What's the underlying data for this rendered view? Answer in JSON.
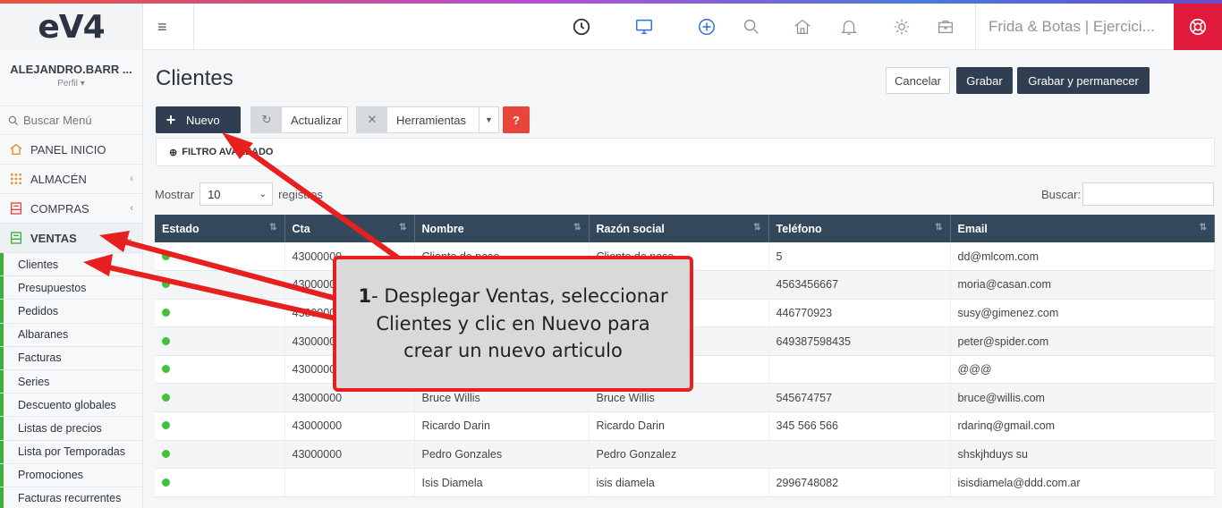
{
  "header": {
    "logo": "eV4",
    "menu_icon": "hamburger-icon",
    "icons": [
      "dashboard-clock-icon",
      "monitor-icon",
      "plus-circle-icon",
      "search-icon",
      "home-icon",
      "bell-icon",
      "gear-icon",
      "briefcase-icon"
    ],
    "company": "Frida & Botas | Ejercici...",
    "help_icon": "lifebuoy-icon"
  },
  "sidebar": {
    "user_name": "ALEJANDRO.BARR ...",
    "user_profile": "Perfil ▾",
    "search_placeholder": "Buscar Menú",
    "items": [
      {
        "label": "PANEL INICIO",
        "icon": "home-icon"
      },
      {
        "label": "ALMACÉN",
        "icon": "grid-icon"
      },
      {
        "label": "COMPRAS",
        "icon": "register-icon"
      },
      {
        "label": "VENTAS",
        "icon": "register-icon"
      }
    ],
    "ventas_sub": [
      "Clientes",
      "Presupuestos",
      "Pedidos",
      "Albaranes",
      "Facturas",
      "Series",
      "Descuento globales",
      "Listas de precios",
      "Lista por Temporadas",
      "Promociones",
      "Facturas recurrentes"
    ]
  },
  "main": {
    "title": "Clientes",
    "cancel_label": "Cancelar",
    "save_label": "Grabar",
    "save_stay_label": "Grabar y permanecer",
    "new_label": "Nuevo",
    "refresh_label": "Actualizar",
    "tools_label": "Herramientas",
    "help_label": "?",
    "filter_label": "FILTRO AVANZADO",
    "show_label": "Mostrar",
    "page_size": "10",
    "records_label": "registros",
    "search_label": "Buscar:",
    "columns": [
      "Estado",
      "Cta",
      "Nombre",
      "Razón social",
      "Teléfono",
      "Email"
    ],
    "rows": [
      {
        "cta": "43000000",
        "nombre": "Cliente de paso",
        "razon": "Cliente de paso",
        "telefono": "5",
        "email": "dd@mlcom.com"
      },
      {
        "cta": "43000000",
        "nombre": "",
        "razon": "",
        "telefono": "4563456667",
        "email": "moria@casan.com"
      },
      {
        "cta": "43000000",
        "nombre": "",
        "razon": "",
        "telefono": "446770923",
        "email": "susy@gimenez.com"
      },
      {
        "cta": "43000000",
        "nombre": "",
        "razon": "",
        "telefono": "649387598435",
        "email": "peter@spider.com"
      },
      {
        "cta": "43000000",
        "nombre": "",
        "razon": "",
        "telefono": "",
        "email": "@@@"
      },
      {
        "cta": "43000000",
        "nombre": "Bruce Willis",
        "razon": "Bruce Willis",
        "telefono": "545674757",
        "email": "bruce@willis.com"
      },
      {
        "cta": "43000000",
        "nombre": "Ricardo Darin",
        "razon": "Ricardo Darin",
        "telefono": "345 566 566",
        "email": "rdarinq@gmail.com"
      },
      {
        "cta": "43000000",
        "nombre": "Pedro Gonzales",
        "razon": "Pedro Gonzalez",
        "telefono": "",
        "email": "shskjhduys su"
      },
      {
        "cta": "",
        "nombre": "Isis Diamela",
        "razon": "isis diamela",
        "telefono": "2996748082",
        "email": "isisdiamela@ddd.com.ar"
      }
    ]
  },
  "annotation": {
    "step": "1",
    "text": "- Desplegar Ventas, seleccionar Clientes y clic en Nuevo para crear un nuevo articulo",
    "color": "#e81f1f"
  }
}
